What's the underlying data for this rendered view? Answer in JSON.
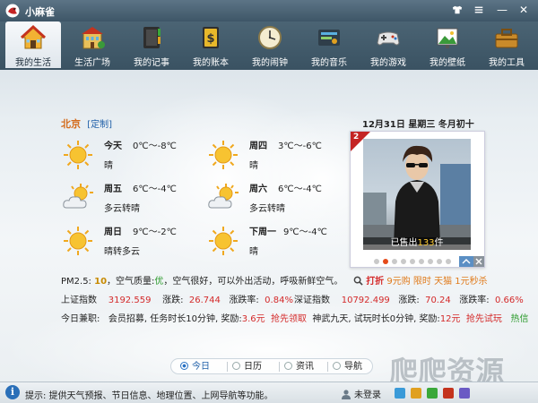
{
  "app": {
    "title": "小麻雀"
  },
  "window": {
    "skin_icon": "shirt-icon",
    "menu_icon": "menu-icon",
    "minimize": "—",
    "close": "✕"
  },
  "toolbar": {
    "items": [
      {
        "label": "我的生活",
        "icon": "house-icon",
        "active": true
      },
      {
        "label": "生活广场",
        "icon": "building-icon",
        "active": false
      },
      {
        "label": "我的记事",
        "icon": "notebook-icon",
        "active": false
      },
      {
        "label": "我的账本",
        "icon": "ledger-icon",
        "active": false
      },
      {
        "label": "我的闹钟",
        "icon": "clock-icon",
        "active": false
      },
      {
        "label": "我的音乐",
        "icon": "music-icon",
        "active": false
      },
      {
        "label": "我的游戏",
        "icon": "gamepad-icon",
        "active": false
      },
      {
        "label": "我的壁纸",
        "icon": "wallpaper-icon",
        "active": false
      },
      {
        "label": "我的工具",
        "icon": "toolbox-icon",
        "active": false
      }
    ]
  },
  "weather": {
    "city": "北京",
    "custom_label": "[定制]",
    "days": [
      {
        "day": "今天",
        "temp": "0℃～-8℃",
        "desc": "晴",
        "icon": "sunny-icon"
      },
      {
        "day": "周四",
        "temp": "3℃～-6℃",
        "desc": "晴",
        "icon": "sunny-icon"
      },
      {
        "day": "周五",
        "temp": "6℃～-4℃",
        "desc": "多云转晴",
        "icon": "partly-cloudy-icon"
      },
      {
        "day": "周六",
        "temp": "6℃～-4℃",
        "desc": "多云转晴",
        "icon": "partly-cloudy-icon"
      },
      {
        "day": "周日",
        "temp": "9℃～-2℃",
        "desc": "晴转多云",
        "icon": "sunny-icon"
      },
      {
        "day": "下周一",
        "temp": "9℃～-4℃",
        "desc": "晴",
        "icon": "sunny-icon"
      }
    ]
  },
  "date": {
    "text": "12月31日  星期三  冬月初十"
  },
  "ad": {
    "tag": "2",
    "sold_prefix": "已售出",
    "sold_count": "133",
    "sold_suffix": "件",
    "dots": 9,
    "active_dot": 1
  },
  "search": {
    "hot": "打折",
    "promo": "9元购 限时 天猫 1元秒杀"
  },
  "pm25": {
    "label": "PM2.5:",
    "value": "10",
    "quality_label": "，空气质量:",
    "quality": "优",
    "advice": "，空气很好，可以外出活动，呼吸新鲜空气。"
  },
  "stocks": [
    {
      "name": "上证指数",
      "value": "3192.559",
      "change_label": "涨跌:",
      "change": "26.744",
      "rate_label": "涨跌率:",
      "rate": "0.84%"
    },
    {
      "name": "深证指数",
      "value": "10792.499",
      "change_label": "涨跌:",
      "change": "70.24",
      "rate_label": "涨跌率:",
      "rate": "0.66%"
    }
  ],
  "todo": {
    "label": "今日兼职:",
    "task1": "会员招募, 任务时长10分钟, 奖励:",
    "reward1": "3.6元",
    "action1": "抢先领取",
    "task2": "神武九天, 试玩时长0分钟, 奖励:",
    "reward2": "12元",
    "action2": "抢先试玩",
    "hot": "热信"
  },
  "bottom_tabs": [
    {
      "label": "今日",
      "active": true
    },
    {
      "label": "日历",
      "active": false
    },
    {
      "label": "资讯",
      "active": false
    },
    {
      "label": "导航",
      "active": false
    }
  ],
  "status": {
    "tip": "提示: 提供天气预报、节日信息、地理位置、上网导航等功能。",
    "login": "未登录"
  }
}
